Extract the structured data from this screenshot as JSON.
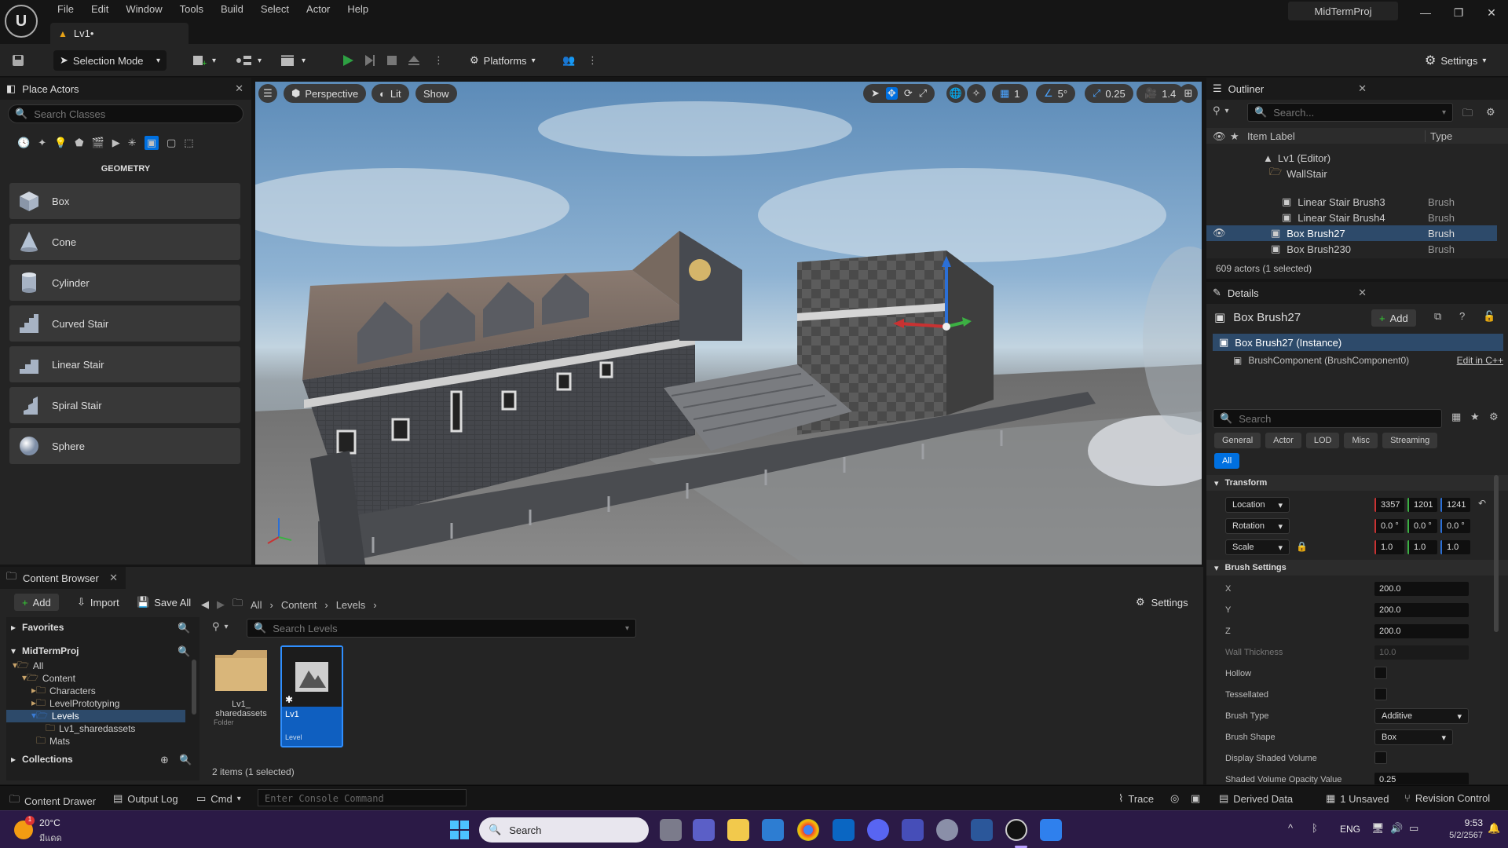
{
  "app": {
    "menu": [
      "File",
      "Edit",
      "Window",
      "Tools",
      "Build",
      "Select",
      "Actor",
      "Help"
    ],
    "level_tab": "Lv1•",
    "project_name": "MidTermProj",
    "window_controls": [
      "minimize",
      "restore",
      "close"
    ]
  },
  "toolbar": {
    "selection_mode": "Selection Mode",
    "platforms": "Platforms",
    "settings": "Settings"
  },
  "place_actors": {
    "title": "Place Actors",
    "search_placeholder": "Search Classes",
    "category": "GEOMETRY",
    "items": [
      "Box",
      "Cone",
      "Cylinder",
      "Curved Stair",
      "Linear Stair",
      "Spiral Stair",
      "Sphere"
    ]
  },
  "viewport": {
    "perspective": "Perspective",
    "lit": "Lit",
    "show": "Show",
    "grid_snap": "1",
    "angle_snap": "5°",
    "scale_snap": "0.25",
    "camera_speed": "1.4"
  },
  "outliner": {
    "title": "Outliner",
    "search_placeholder": "Search...",
    "col_label": "Item Label",
    "col_type": "Type",
    "rows": [
      {
        "label": "Lv1 (Editor)",
        "type": ""
      },
      {
        "label": "WallStair",
        "type": ""
      },
      {
        "label": "Linear Stair Brush3",
        "type": "Brush"
      },
      {
        "label": "Linear Stair Brush4",
        "type": "Brush"
      },
      {
        "label": "Box Brush27",
        "type": "Brush"
      },
      {
        "label": "Box Brush230",
        "type": "Brush"
      }
    ],
    "status": "609 actors (1 selected)"
  },
  "details": {
    "title": "Details",
    "actor_name": "Box Brush27",
    "add": "Add",
    "instance": "Box Brush27 (Instance)",
    "component": "BrushComponent (BrushComponent0)",
    "edit_cpp": "Edit in C++",
    "search_placeholder": "Search",
    "tabs": [
      "General",
      "Actor",
      "LOD",
      "Misc",
      "Streaming"
    ],
    "tab_all": "All",
    "transform_header": "Transform",
    "location_label": "Location",
    "location": [
      "3357",
      "1201",
      "1241"
    ],
    "rotation_label": "Rotation",
    "rotation": [
      "0.0 °",
      "0.0 °",
      "0.0 °"
    ],
    "scale_label": "Scale",
    "scale": [
      "1.0",
      "1.0",
      "1.0"
    ],
    "brush_header": "Brush Settings",
    "x_label": "X",
    "x_value": "200.0",
    "y_label": "Y",
    "y_value": "200.0",
    "z_label": "Z",
    "z_value": "200.0",
    "wall_label": "Wall Thickness",
    "wall_value": "10.0",
    "hollow_label": "Hollow",
    "tess_label": "Tessellated",
    "brush_type_label": "Brush Type",
    "brush_type": "Additive",
    "brush_shape_label": "Brush Shape",
    "brush_shape": "Box",
    "shaded_label": "Display Shaded Volume",
    "opacity_label": "Shaded Volume Opacity Value",
    "opacity_value": "0.25"
  },
  "content_browser": {
    "title": "Content Browser",
    "add": "Add",
    "import": "Import",
    "save_all": "Save All",
    "path": [
      "All",
      "Content",
      "Levels"
    ],
    "settings": "Settings",
    "favorites": "Favorites",
    "project": "MidTermProj",
    "tree": [
      "All",
      "Content",
      "Characters",
      "LevelPrototyping",
      "Levels",
      "Lv1_sharedassets",
      "Mats"
    ],
    "collections": "Collections",
    "search_placeholder": "Search Levels",
    "assets": [
      {
        "name": "Lv1_ sharedassets",
        "kind": "Folder"
      },
      {
        "name": "Lv1",
        "kind": "Level"
      }
    ],
    "status": "2 items (1 selected)"
  },
  "statusbar": {
    "content_drawer": "Content Drawer",
    "output_log": "Output Log",
    "cmd": "Cmd",
    "console_placeholder": "Enter Console Command",
    "trace": "Trace",
    "derived_data": "Derived Data",
    "unsaved": "1 Unsaved",
    "revision": "Revision Control"
  },
  "taskbar": {
    "weather_temp": "20°C",
    "weather_text": "มีแดด",
    "weather_badge": "1",
    "search": "Search",
    "lang": "ENG",
    "time": "9:53",
    "date": "5/2/2567"
  },
  "colors": {
    "accent": "#0070e0",
    "play": "#2ea043",
    "x_axis": "#c83232",
    "y_axis": "#3cb043",
    "z_axis": "#2b6fd6"
  }
}
